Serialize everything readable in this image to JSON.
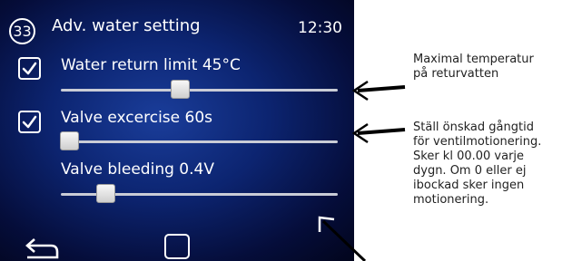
{
  "header": {
    "page_number": "33",
    "title": "Adv. water setting",
    "time": "12:30"
  },
  "settings": [
    {
      "label": "Water return limit 45°C",
      "checked": true,
      "value": 45
    },
    {
      "label": "Valve excercise 60s",
      "checked": true,
      "value": 60
    },
    {
      "label": "Valve bleeding 0.4V",
      "checked": false,
      "value": 0.4
    }
  ],
  "slider_levels": [
    0.43,
    0.03,
    0.16
  ],
  "nav": {
    "back_icon": "back-arrow-icon",
    "home_icon": "home-square-icon"
  },
  "annotations": [
    {
      "lines": [
        "Maximal temperatur",
        "på returvatten"
      ]
    },
    {
      "lines": [
        "Ställ önskad gångtid",
        "för ventilmotionering.",
        "Sker kl 00.00 varje",
        "dygn. Om 0 eller ej",
        "ibockad sker ingen",
        "motionering."
      ]
    }
  ],
  "colors": {
    "screen_bg": "#0c2470",
    "text": "#ffffff",
    "annotation_text": "#222222"
  }
}
